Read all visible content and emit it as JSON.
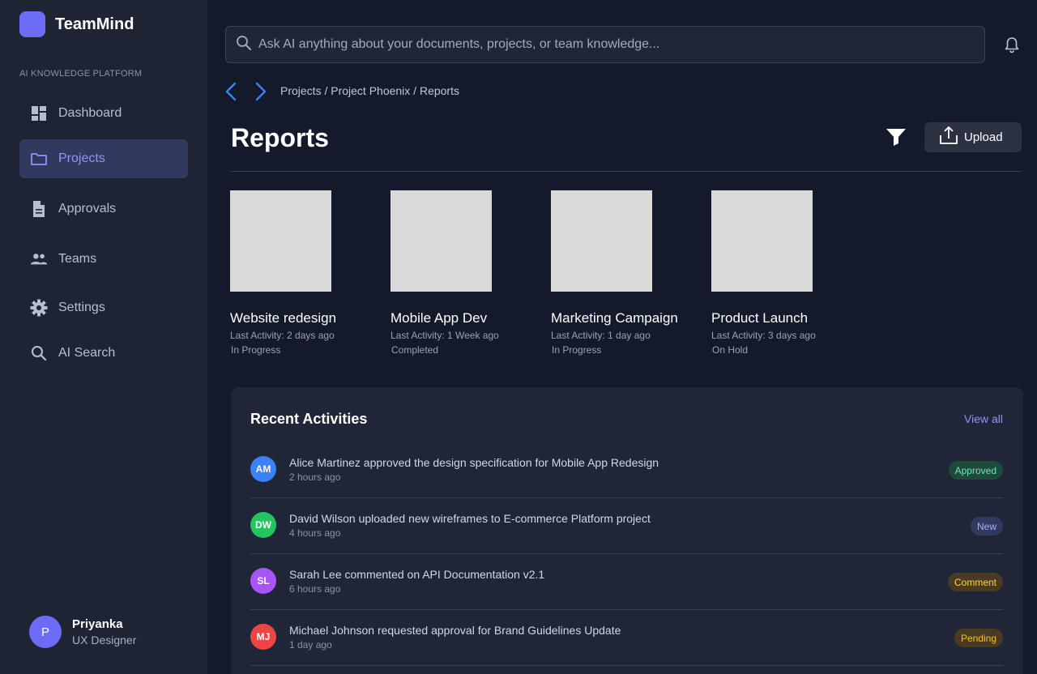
{
  "app": {
    "name": "TeamMind",
    "caption": "AI KNOWLEDGE PLATFORM"
  },
  "sidebar": {
    "items": [
      {
        "label": "Dashboard",
        "icon": "dashboard-icon",
        "active": false
      },
      {
        "label": "Projects",
        "icon": "folder-icon",
        "active": true
      },
      {
        "label": "Approvals",
        "icon": "document-icon",
        "active": false
      },
      {
        "label": "Teams",
        "icon": "people-icon",
        "active": false
      },
      {
        "label": "Settings",
        "icon": "gear-icon",
        "active": false
      },
      {
        "label": "AI Search",
        "icon": "search-icon",
        "active": false
      }
    ]
  },
  "user": {
    "initial": "P",
    "name": "Priyanka",
    "role": "UX Designer"
  },
  "search": {
    "placeholder": "Ask AI anything about your documents, projects, or team knowledge..."
  },
  "breadcrumb": "Projects / Project Phoenix / Reports",
  "page": {
    "title": "Reports",
    "upload_label": "Upload"
  },
  "projects": [
    {
      "title": "Website redesign",
      "activity": "Last Activity: 2 days ago",
      "status": "In Progress"
    },
    {
      "title": "Mobile App Dev",
      "activity": "Last Activity: 1 Week ago",
      "status": "Completed"
    },
    {
      "title": "Marketing Campaign",
      "activity": "Last Activity: 1 day ago",
      "status": "In Progress"
    },
    {
      "title": "Product Launch",
      "activity": "Last Activity: 3 days ago",
      "status": "On Hold"
    }
  ],
  "activities": {
    "title": "Recent Activities",
    "view_all": "View all",
    "items": [
      {
        "initials": "AM",
        "avatar_color": "#3b82f6",
        "text": "Alice Martinez approved the design specification for Mobile App Redesign",
        "time": "2 hours ago",
        "badge": "Approved",
        "badge_bg": "#1f4a3a",
        "badge_fg": "#6ee7b7"
      },
      {
        "initials": "DW",
        "avatar_color": "#22c55e",
        "text": "David Wilson uploaded new wireframes to E-commerce Platform project",
        "time": "4 hours ago",
        "badge": "New",
        "badge_bg": "#313a5e",
        "badge_fg": "#a5b4fc"
      },
      {
        "initials": "SL",
        "avatar_color": "#a855f7",
        "text": "Sarah Lee commented on API Documentation v2.1",
        "time": "6 hours ago",
        "badge": "Comment",
        "badge_bg": "#4a3a22",
        "badge_fg": "#fcd34d"
      },
      {
        "initials": "MJ",
        "avatar_color": "#ef4444",
        "text": "Michael Johnson requested approval for Brand Guidelines Update",
        "time": "1 day ago",
        "badge": "Pending",
        "badge_bg": "#4a3a22",
        "badge_fg": "#fbbf24"
      }
    ]
  },
  "colors": {
    "accent": "#6c6cf7",
    "link": "#8f95f5",
    "arrow": "#3b82f6"
  }
}
